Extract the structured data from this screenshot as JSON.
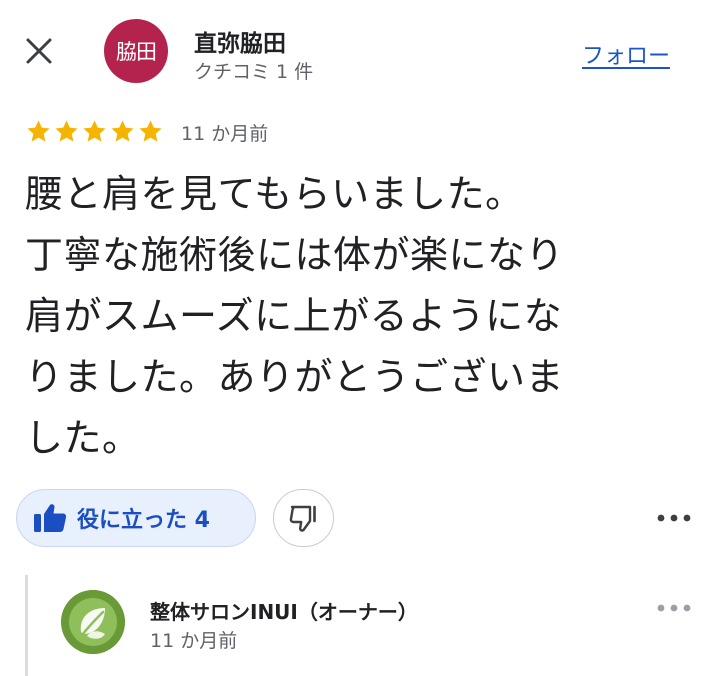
{
  "header": {
    "close_icon": "close-icon",
    "avatar_text": "脇田",
    "avatar_color": "#b3234e",
    "reviewer_name": "直弥脇田",
    "reviewer_meta": "クチコミ 1 件",
    "follow_label": "フォロー",
    "accent_color": "#1a56c8"
  },
  "review": {
    "rating": 5,
    "rating_max": 5,
    "star_color": "#f5b400",
    "date": "11 か月前",
    "text": "腰と肩を見てもらいました。\n丁寧な施術後には体が楽になり\n肩がスムーズに上がるようにな\nりました。ありがとうございま\nした。"
  },
  "actions": {
    "helpful_icon": "thumbs-up-icon",
    "helpful_label": "役に立った 4",
    "dislike_icon": "thumbs-down-icon",
    "more_icon": "more-horizontal-icon"
  },
  "owner_reply": {
    "avatar_icon": "leaf-logo-icon",
    "name": "整体サロンINUI（オーナー）",
    "date": "11 か月前",
    "more_icon": "more-horizontal-icon"
  }
}
